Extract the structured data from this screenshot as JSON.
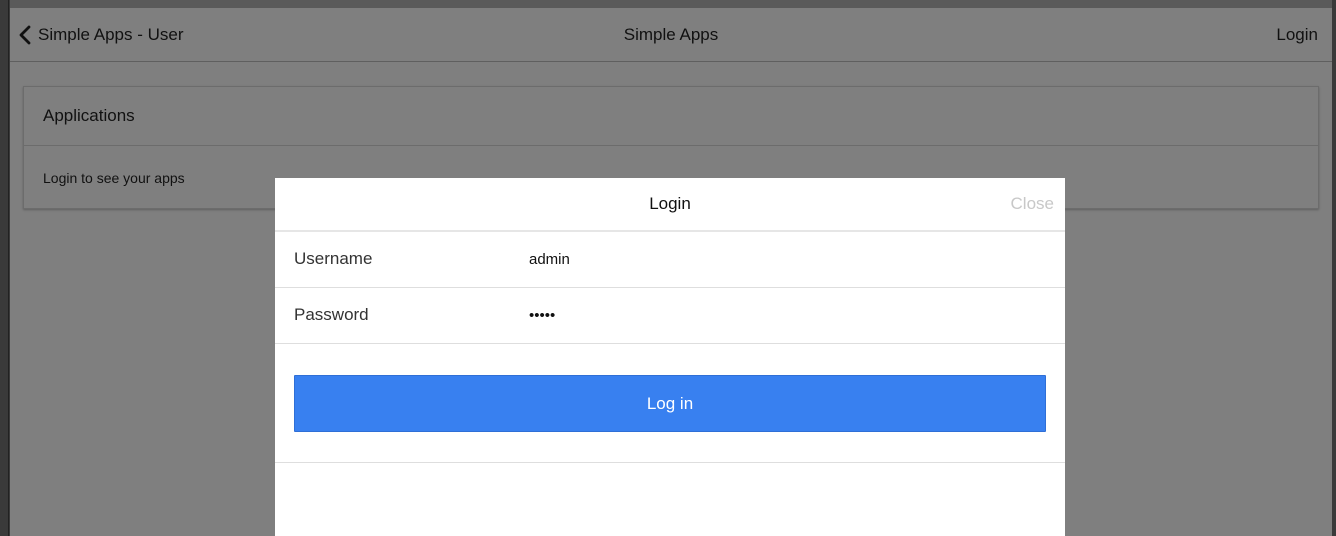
{
  "nav": {
    "back_label": "Simple Apps - User",
    "title": "Simple Apps",
    "login_label": "Login"
  },
  "applications": {
    "header": "Applications",
    "message": "Login to see your apps"
  },
  "modal": {
    "title": "Login",
    "close_label": "Close",
    "username_label": "Username",
    "username_value": "admin",
    "password_label": "Password",
    "password_value": "admin",
    "submit_label": "Log in"
  },
  "colors": {
    "primary_button": "#3880f0",
    "overlay_gray": "#7f7f7f"
  },
  "icons": {
    "back": "chevron-left-icon"
  }
}
